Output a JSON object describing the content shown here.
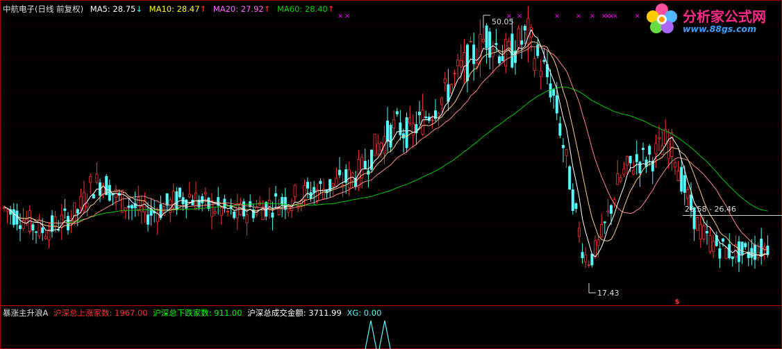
{
  "header": {
    "stock": "中航电子(日线 前复权)",
    "ma5": {
      "label": "MA5: 28.75",
      "arrow": "↓",
      "color": "#ffffff"
    },
    "ma10": {
      "label": "MA10: 28.47",
      "arrow": "↑",
      "color": "#ffff00"
    },
    "ma20": {
      "label": "MA20: 27.92",
      "arrow": "↑",
      "color": "#ff66ff"
    },
    "ma60": {
      "label": "MA60: 28.40",
      "arrow": "↑",
      "color": "#00cc00"
    }
  },
  "annotations": {
    "high": "50.05",
    "low": "17.43",
    "level": "26.58 - 26.46",
    "signal": "$"
  },
  "sub_indicator": {
    "name": "暴涨主升浪A",
    "up": "沪深总上涨家数: 1967.00",
    "down": "沪深总下跌家数: 911.00",
    "amount": "沪深总成交金额: 3711.99",
    "xg": "XG: 0.00"
  },
  "logo": {
    "text": "分析家公式网",
    "url": "www.88gs.com"
  },
  "colors": {
    "up": "#ff3232",
    "down": "#54fcfc",
    "ma5": "#ffffff",
    "ma10": "#ffff00",
    "ma20": "#ff66ff",
    "ma60": "#00cc00",
    "mark": "#ff00ff",
    "grid": "#7a0000"
  },
  "chart_data": {
    "type": "line",
    "title": "中航电子(日线 前复权)",
    "ylim": [
      14,
      54
    ],
    "x": [
      0,
      10,
      20,
      30,
      40,
      50,
      60,
      70,
      80,
      90,
      100,
      110,
      120,
      130,
      140,
      150,
      160,
      170,
      180,
      190,
      200,
      205,
      210,
      220,
      230,
      240,
      250,
      260,
      270,
      280,
      290,
      300,
      310,
      320,
      330,
      340,
      350,
      360,
      370,
      380,
      390,
      400,
      410,
      420,
      430,
      440,
      450,
      460,
      470,
      480,
      490,
      500,
      510,
      520,
      530,
      540,
      550,
      560,
      570,
      580,
      590,
      600,
      610,
      620,
      630,
      640,
      650,
      660,
      670,
      680,
      690,
      695,
      700,
      710,
      720,
      730,
      740,
      750,
      760,
      770,
      780,
      790,
      800,
      810,
      820,
      830,
      840,
      845,
      850,
      860,
      870,
      880,
      890,
      900,
      910,
      920,
      930,
      940,
      950,
      960,
      970,
      980,
      990,
      1000,
      1010,
      1020,
      1030,
      1040,
      1050,
      1060,
      1070,
      1080,
      1090,
      1100,
      1106
    ],
    "series": [
      {
        "name": "close",
        "values": [
          27,
          26.5,
          26,
          25.5,
          25,
          24.2,
          23.8,
          24,
          24.5,
          25,
          25.6,
          26,
          27.5,
          29.5,
          30,
          30.2,
          29,
          28,
          27.5,
          27,
          26.5,
          26.2,
          26,
          26.2,
          26.6,
          27,
          27.5,
          28,
          28.5,
          28,
          27.5,
          27,
          26.8,
          26.5,
          26,
          25.8,
          26.2,
          26.5,
          26.8,
          27,
          27.2,
          27.5,
          27.8,
          28,
          28.3,
          28.6,
          29,
          29.2,
          29.5,
          29.8,
          30,
          30.5,
          31,
          31.5,
          33,
          34.5,
          35.5,
          36.5,
          37.5,
          37,
          36.5,
          37.5,
          38.5,
          39.5,
          40.5,
          41.5,
          43,
          44.5,
          45.5,
          46.5,
          47.5,
          48.5,
          49.5,
          48.5,
          47.5,
          46.5,
          47.5,
          48.5,
          49.5,
          47,
          45.5,
          43.5,
          40.5,
          35.5,
          30.5,
          25.5,
          21,
          20.2,
          20,
          21.5,
          24,
          27,
          30,
          31.5,
          32.5,
          33,
          33.2,
          33.5,
          34.5,
          35.5,
          34.5,
          31,
          28,
          25.5,
          23.5,
          22.5,
          22,
          21.5,
          21,
          21,
          20.8,
          21,
          21.3,
          21.5,
          21.8
        ]
      }
    ]
  }
}
